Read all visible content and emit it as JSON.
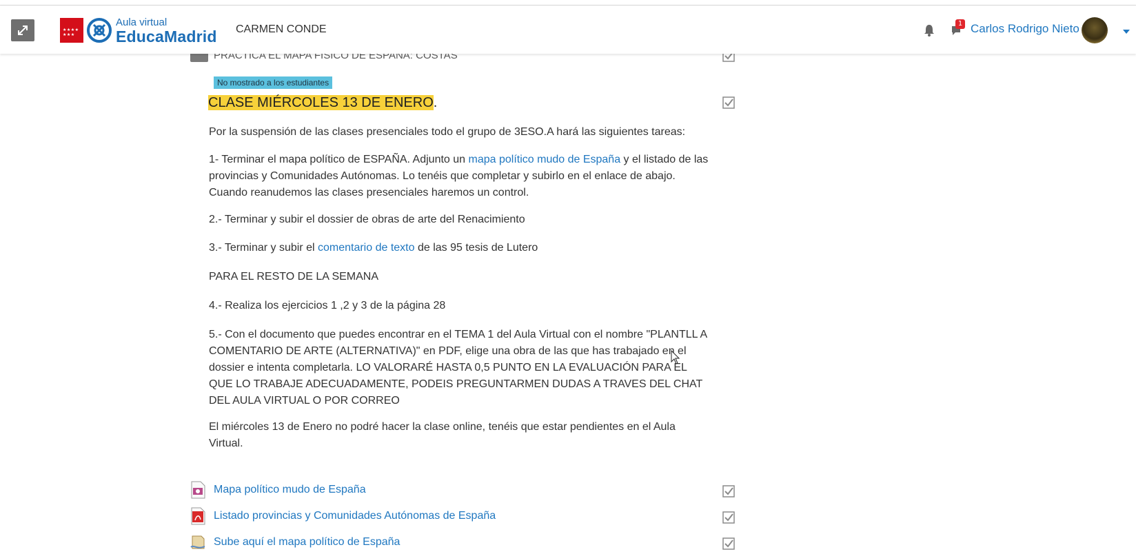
{
  "header": {
    "logo_small": "Aula virtual",
    "logo_big": "EducaMadrid",
    "site_name": "CARMEN CONDE",
    "message_count": "1",
    "user_name": "Carlos Rodrigo Nieto"
  },
  "section": {
    "prev_item": "PRÁCTICA EL MAPA FÍSICO DE ESPAÑA: COSTAS",
    "hidden_badge": "No mostrado a los estudiantes",
    "title_highlight": "CLASE MIÉRCOLES 13 DE ENERO",
    "title_suffix": ".",
    "intro": "Por la suspensión de las clases presenciales todo el grupo de 3ESO.A hará las siguientes tareas:",
    "item1_pre": "1- Terminar el  mapa político de ESPAÑA. Adjunto un ",
    "item1_link": "mapa político mudo de España",
    "item1_post": " y el listado de las provincias y Comunidades Autónomas. Lo tenéis que completar y subirlo en el enlace de abajo. Cuando reanudemos las clases presenciales haremos un control.",
    "item2": "2.- Terminar y subir el dossier de obras de arte del Renacimiento",
    "item3_pre": "3.- Terminar y subir el ",
    "item3_link": "comentario de texto",
    "item3_post": " de las 95 tesis de Lutero",
    "rest_week": "PARA EL RESTO DE LA SEMANA",
    "item4": "4.- Realiza los ejercicios 1 ,2 y 3 de la página 28",
    "item5": "5.- Con el documento que puedes encontrar en el TEMA 1 del Aula Virtual con el nombre \"PLANTLL A COMENTARIO DE ARTE (ALTERNATIVA)\" en PDF, elige una obra de las que has trabajado en el dossier e intenta completarla. LO VALORARÉ HASTA 0,5 PUNTO EN LA EVALUACIÓN PARA EL QUE LO TRABAJE  ADECUADAMENTE, PODEIS PREGUNTARMEN DUDAS A TRAVES DEL CHAT DEL AULA VIRTUAL O POR CORREO",
    "closing": "El miércoles 13 de Enero no podré hacer la clase online, tenéis que estar pendientes en el Aula Virtual."
  },
  "activities": [
    {
      "label": "Mapa político mudo de España",
      "icon": "image-file-icon"
    },
    {
      "label": "Listado provincias y Comunidades Autónomas de España",
      "icon": "pdf-file-icon"
    },
    {
      "label": "Sube aquí el mapa político de España",
      "icon": "assignment-icon"
    }
  ],
  "colors": {
    "link": "#1f77c0",
    "highlight": "#f7d13a",
    "badge": "#5bc0de",
    "notification": "#e0262c"
  }
}
